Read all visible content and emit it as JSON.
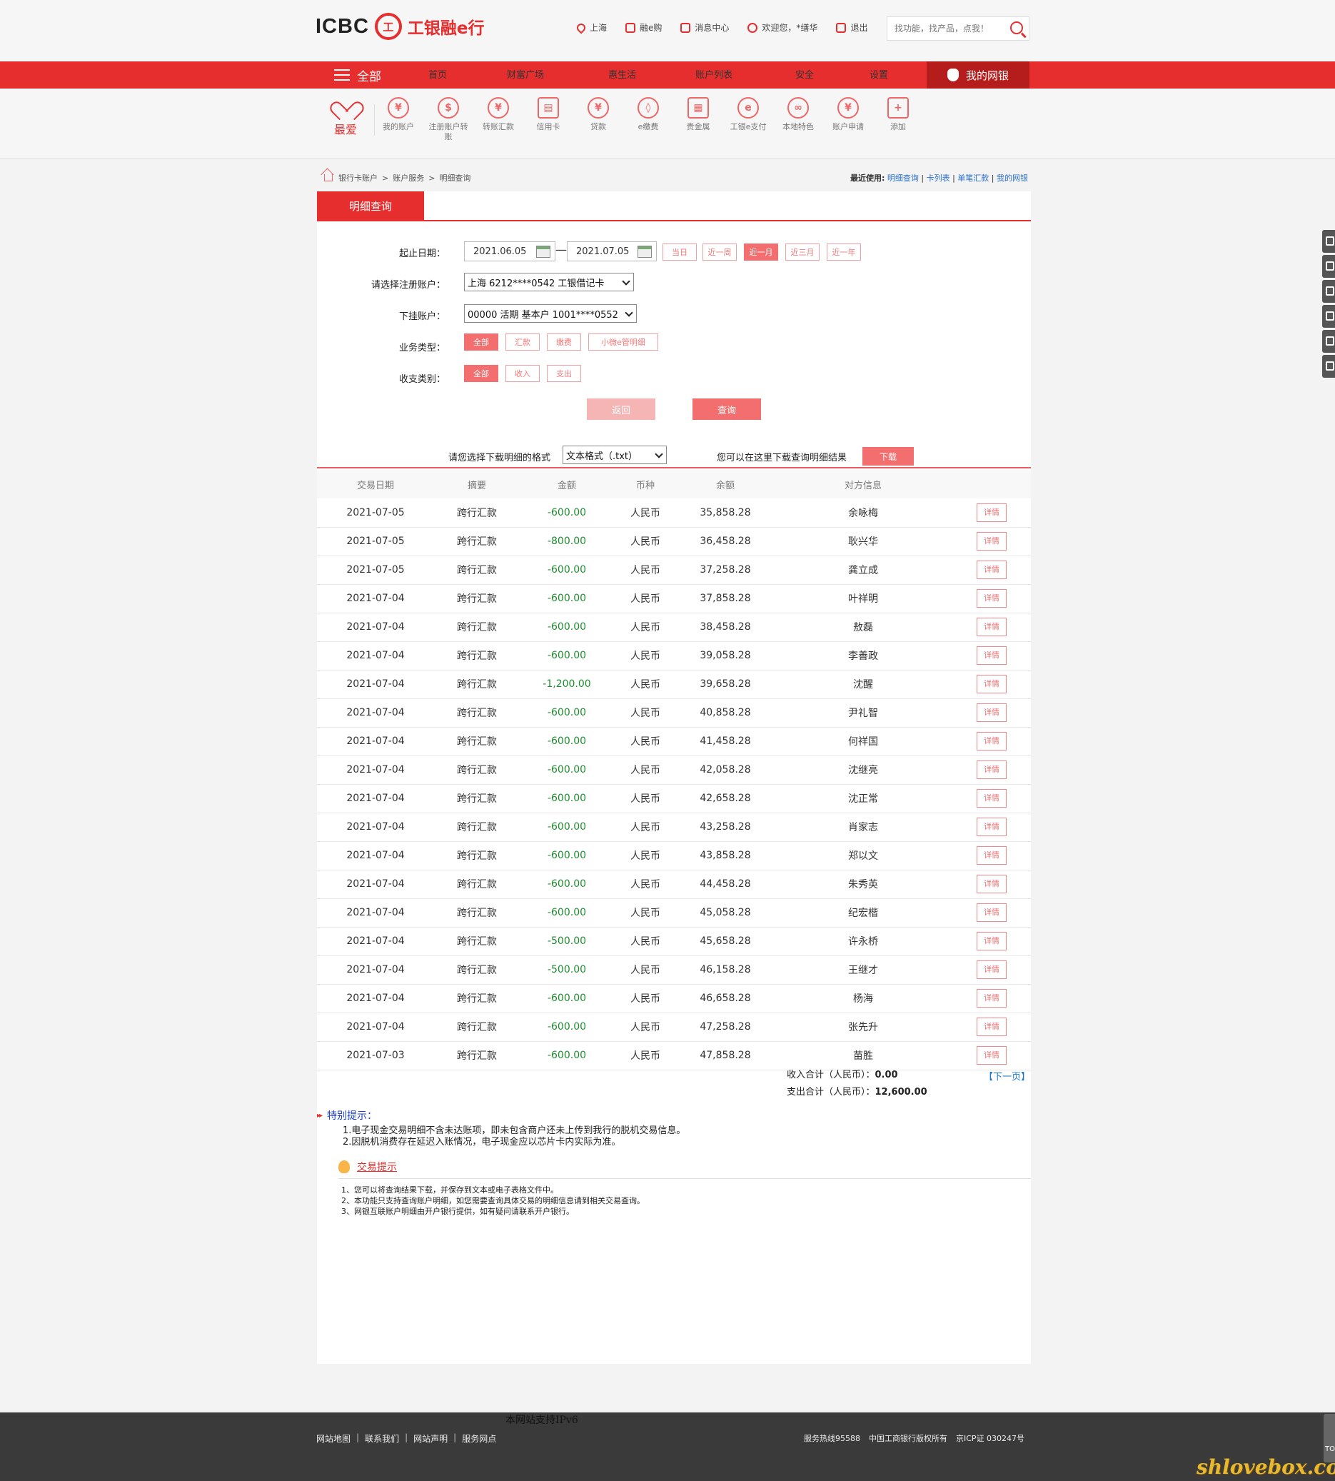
{
  "header": {
    "logo_en": "ICBC",
    "logo_seal": "工",
    "logo_cn": "工银融e行",
    "links": [
      {
        "label": "上海",
        "icon": "location-pin-icon"
      },
      {
        "label": "融e购",
        "icon": "cart-icon"
      },
      {
        "label": "消息中心",
        "icon": "mail-icon"
      },
      {
        "label": "欢迎您，*缮华",
        "icon": "user-icon"
      },
      {
        "label": "退出",
        "icon": "logout-icon"
      }
    ],
    "search_placeholder": "找功能，找产品，点我！"
  },
  "nav": {
    "all_label": "全部",
    "items": [
      "首页",
      "财富广场",
      "惠生活",
      "账户列表",
      "安全",
      "设置"
    ],
    "mybank_label": "我的网银",
    "accent_color": "#e62e2e"
  },
  "shortcuts": {
    "favorite_label": "最爱",
    "items": [
      {
        "label": "我的账户",
        "glyph": "¥"
      },
      {
        "label": "注册账户转账",
        "glyph": "$"
      },
      {
        "label": "转账汇款",
        "glyph": "¥"
      },
      {
        "label": "信用卡",
        "glyph": "▤"
      },
      {
        "label": "贷款",
        "glyph": "¥"
      },
      {
        "label": "e缴费",
        "glyph": "◊"
      },
      {
        "label": "贵金属",
        "glyph": "▦"
      },
      {
        "label": "工银e支付",
        "glyph": "e"
      },
      {
        "label": "本地特色",
        "glyph": "∞"
      },
      {
        "label": "账户申请",
        "glyph": "¥"
      },
      {
        "label": "添加",
        "glyph": "+"
      }
    ]
  },
  "breadcrumb": {
    "items": [
      "银行卡账户",
      "账户服务",
      "明细查询"
    ],
    "separator": ">",
    "recent_label": "最近使用:",
    "recent_links": [
      "明细查询",
      "卡列表",
      "单笔汇款",
      "我的网银"
    ]
  },
  "tab": {
    "active_label": "明细查询"
  },
  "form": {
    "date_label": "起止日期：",
    "start_date": "2021.06.05",
    "end_date": "2021.07.05",
    "date_dash": "—",
    "quick_ranges": [
      {
        "label": "当日",
        "active": false
      },
      {
        "label": "近一周",
        "active": false
      },
      {
        "label": "近一月",
        "active": true
      },
      {
        "label": "近三月",
        "active": false
      },
      {
        "label": "近一年",
        "active": false
      }
    ],
    "account_label": "请选择注册账户：",
    "account_value": "上海 6212****0542 工银借记卡",
    "sub_account_label": "下挂账户：",
    "sub_account_value": "00000 活期 基本户 1001****0552",
    "biz_type_label": "业务类型：",
    "biz_types": [
      {
        "label": "全部",
        "active": true
      },
      {
        "label": "汇款",
        "active": false
      },
      {
        "label": "缴费",
        "active": false
      },
      {
        "label": "小微e管明细",
        "active": false
      }
    ],
    "flow_label": "收支类别：",
    "flow_types": [
      {
        "label": "全部",
        "active": true
      },
      {
        "label": "收入",
        "active": false
      },
      {
        "label": "支出",
        "active": false
      }
    ],
    "back_button": "返回",
    "query_button": "查询"
  },
  "download": {
    "format_label": "请您选择下载明细的格式",
    "format_value": "文本格式（.txt）",
    "hint": "您可以在这里下载查询明细结果",
    "button": "下载"
  },
  "table": {
    "headers": [
      "交易日期",
      "摘要",
      "金额",
      "币种",
      "余额",
      "对方信息",
      ""
    ],
    "detail_button": "详情",
    "rows": [
      [
        "2021-07-05",
        "跨行汇款",
        "-600.00",
        "人民币",
        "35,858.28",
        "余咏梅"
      ],
      [
        "2021-07-05",
        "跨行汇款",
        "-800.00",
        "人民币",
        "36,458.28",
        "耿兴华"
      ],
      [
        "2021-07-05",
        "跨行汇款",
        "-600.00",
        "人民币",
        "37,258.28",
        "龚立成"
      ],
      [
        "2021-07-04",
        "跨行汇款",
        "-600.00",
        "人民币",
        "37,858.28",
        "叶祥明"
      ],
      [
        "2021-07-04",
        "跨行汇款",
        "-600.00",
        "人民币",
        "38,458.28",
        "敖磊"
      ],
      [
        "2021-07-04",
        "跨行汇款",
        "-600.00",
        "人民币",
        "39,058.28",
        "李善政"
      ],
      [
        "2021-07-04",
        "跨行汇款",
        "-1,200.00",
        "人民币",
        "39,658.28",
        "沈醒"
      ],
      [
        "2021-07-04",
        "跨行汇款",
        "-600.00",
        "人民币",
        "40,858.28",
        "尹礼智"
      ],
      [
        "2021-07-04",
        "跨行汇款",
        "-600.00",
        "人民币",
        "41,458.28",
        "何祥国"
      ],
      [
        "2021-07-04",
        "跨行汇款",
        "-600.00",
        "人民币",
        "42,058.28",
        "沈继亮"
      ],
      [
        "2021-07-04",
        "跨行汇款",
        "-600.00",
        "人民币",
        "42,658.28",
        "沈正常"
      ],
      [
        "2021-07-04",
        "跨行汇款",
        "-600.00",
        "人民币",
        "43,258.28",
        "肖家志"
      ],
      [
        "2021-07-04",
        "跨行汇款",
        "-600.00",
        "人民币",
        "43,858.28",
        "郑以文"
      ],
      [
        "2021-07-04",
        "跨行汇款",
        "-600.00",
        "人民币",
        "44,458.28",
        "朱秀英"
      ],
      [
        "2021-07-04",
        "跨行汇款",
        "-600.00",
        "人民币",
        "45,058.28",
        "纪宏楷"
      ],
      [
        "2021-07-04",
        "跨行汇款",
        "-500.00",
        "人民币",
        "45,658.28",
        "许永桥"
      ],
      [
        "2021-07-04",
        "跨行汇款",
        "-500.00",
        "人民币",
        "46,158.28",
        "王继才"
      ],
      [
        "2021-07-04",
        "跨行汇款",
        "-600.00",
        "人民币",
        "46,658.28",
        "杨海"
      ],
      [
        "2021-07-04",
        "跨行汇款",
        "-600.00",
        "人民币",
        "47,258.28",
        "张先升"
      ],
      [
        "2021-07-03",
        "跨行汇款",
        "-600.00",
        "人民币",
        "47,858.28",
        "苗胜"
      ]
    ]
  },
  "totals": {
    "income_label": "收入合计（人民币）：",
    "income_value": "0.00",
    "expense_label": "支出合计（人民币）：",
    "expense_value": "12,600.00",
    "next_page": "【下一页】"
  },
  "notice": {
    "title": "特别提示：",
    "lines": [
      "1.电子现金交易明细不含未达账项，即未包含商户还未上传到我行的脱机交易信息。",
      "2.因脱机消费存在延迟入账情况，电子现金应以芯片卡内实际为准。"
    ]
  },
  "tips": {
    "title": "交易提示",
    "lines": [
      "1、您可以将查询结果下载，并保存到文本或电子表格文件中。",
      "2、本功能只支持查询账户明细，如您需要查询具体交易的明细信息请到相关交易查询。",
      "3、网银互联账户明细由开户银行提供，如有疑问请联系开户银行。"
    ]
  },
  "footer": {
    "ipv6": "本网站支持IPv6",
    "links": [
      "网站地图",
      "联系我们",
      "网站声明",
      "服务网点"
    ],
    "hotline": "服务热线95588",
    "copyright": "中国工商银行版权所有",
    "icp": "京ICP证 030247号"
  },
  "watermark": "shlovebox.com"
}
